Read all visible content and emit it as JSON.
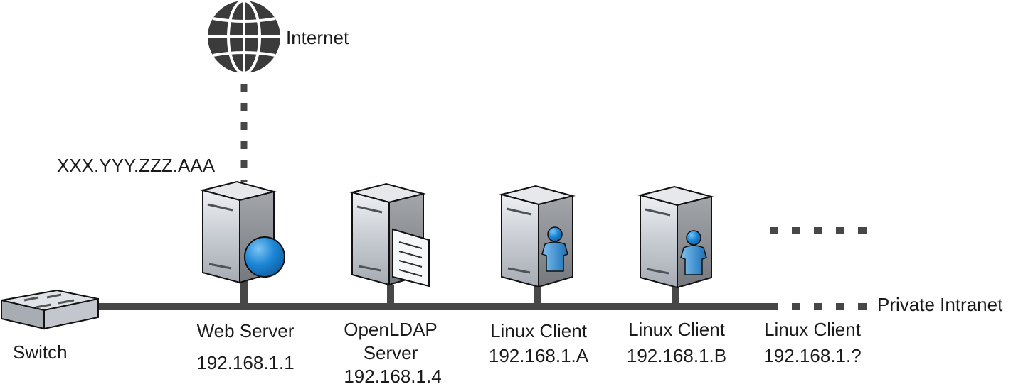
{
  "colors": {
    "line": "#474747",
    "server_light": "#d4d7dd",
    "server_dark": "#8e9196",
    "globe_blue": "#1a7fd0",
    "person_blue": "#2a86cf"
  },
  "internet": {
    "label": "Internet",
    "icon": "globe-icon"
  },
  "public_ip": "XXX.YYY.ZZZ.AAA",
  "switch": {
    "label": "Switch",
    "icon": "switch-icon"
  },
  "network_label": "Private Intranet",
  "nodes": [
    {
      "name": "Web Server",
      "ip": "192.168.1.1",
      "icon": "web-server-icon"
    },
    {
      "name_line1": "OpenLDAP",
      "name_line2": "Server",
      "ip": "192.168.1.4",
      "icon": "directory-server-icon"
    },
    {
      "name": "Linux Client",
      "ip": "192.168.1.A",
      "icon": "client-server-icon"
    },
    {
      "name": "Linux Client",
      "ip": "192.168.1.B",
      "icon": "client-server-icon"
    },
    {
      "name": "Linux Client",
      "ip": "192.168.1.?"
    }
  ]
}
